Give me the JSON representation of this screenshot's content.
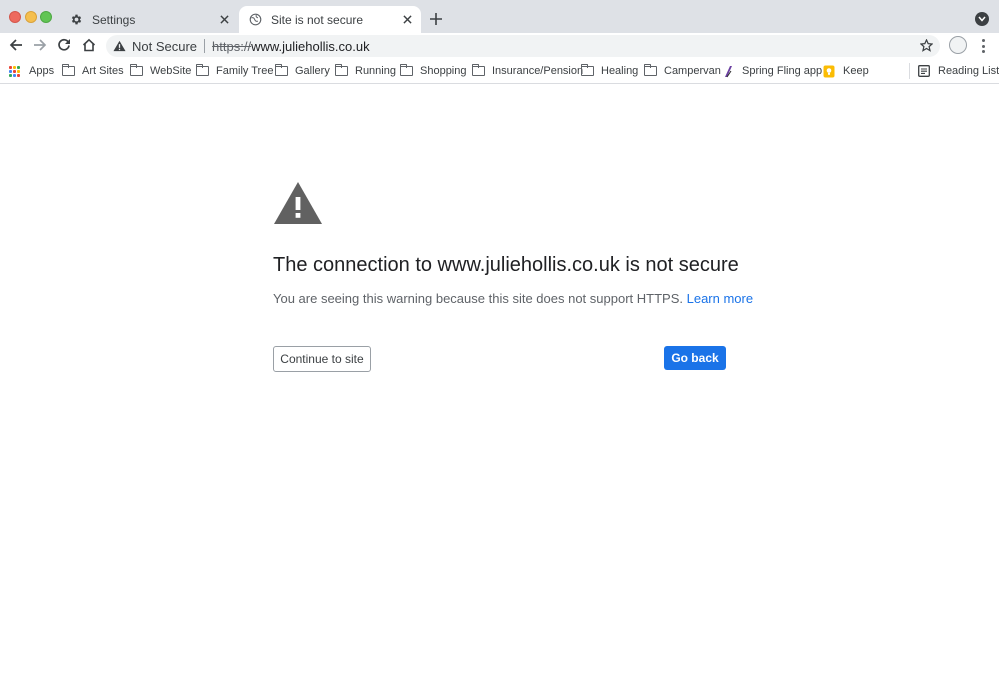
{
  "window": {
    "controls": {
      "close_color": "#ed6a5e",
      "minimize_color": "#f5bf4f",
      "zoom_color": "#61c554"
    }
  },
  "tabs": [
    {
      "title": "Settings",
      "icon": "gear-icon",
      "active": false
    },
    {
      "title": "Site is not secure",
      "icon": "globe-icon",
      "active": true
    }
  ],
  "toolbar": {
    "security_label": "Not Secure",
    "url_scheme": "https://",
    "url_host": "www.juliehollis.co.uk"
  },
  "bookmarks": {
    "items": [
      {
        "label": "Apps",
        "icon": "apps-grid-icon"
      },
      {
        "label": "Art Sites",
        "icon": "folder-icon"
      },
      {
        "label": "WebSite",
        "icon": "folder-icon"
      },
      {
        "label": "Family Tree",
        "icon": "folder-icon"
      },
      {
        "label": "Gallery",
        "icon": "folder-icon"
      },
      {
        "label": "Running",
        "icon": "folder-icon"
      },
      {
        "label": "Shopping",
        "icon": "folder-icon"
      },
      {
        "label": "Insurance/Pension",
        "icon": "folder-icon"
      },
      {
        "label": "Healing",
        "icon": "folder-icon"
      },
      {
        "label": "Campervan",
        "icon": "folder-icon"
      },
      {
        "label": "Spring Fling app",
        "icon": "spring-fling-logo-icon"
      },
      {
        "label": "Keep",
        "icon": "keep-icon"
      }
    ],
    "reading_list": "Reading List"
  },
  "interstitial": {
    "heading": "The connection to www.juliehollis.co.uk is not secure",
    "explanation": "You are seeing this warning because this site does not support HTTPS.",
    "learn_more": "Learn more",
    "continue_label": "Continue to site",
    "back_label": "Go back"
  },
  "colors": {
    "accent": "#1a73e8",
    "tabstrip": "#dee1e6",
    "warning_icon": "#616161"
  }
}
